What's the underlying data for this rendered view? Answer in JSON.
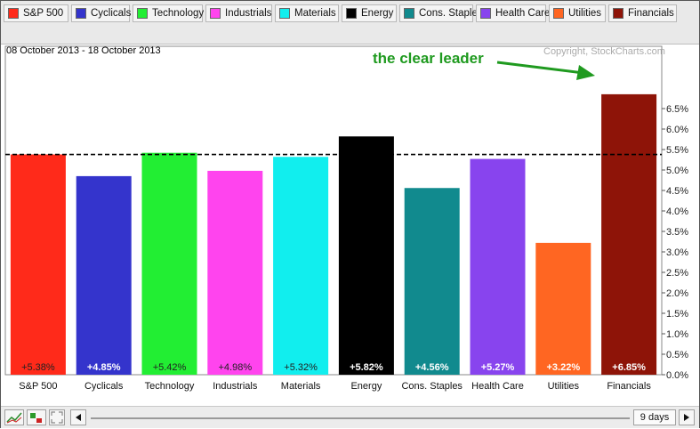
{
  "legend": [
    {
      "label": "S&P 500",
      "color": "#ff2a1a"
    },
    {
      "label": "Cyclicals",
      "color": "#3434cc"
    },
    {
      "label": "Technology",
      "color": "#22ee33"
    },
    {
      "label": "Industrials",
      "color": "#ff44ee"
    },
    {
      "label": "Materials",
      "color": "#11eeee"
    },
    {
      "label": "Energy",
      "color": "#000000"
    },
    {
      "label": "Cons. Staples",
      "color": "#118a8e"
    },
    {
      "label": "Health Care",
      "color": "#8844ee"
    },
    {
      "label": "Utilities",
      "color": "#ff6622"
    },
    {
      "label": "Financials",
      "color": "#8e1408"
    }
  ],
  "header": {
    "date_range": "08 October 2013 - 18 October 2013",
    "copyright": "Copyright, StockCharts.com",
    "annotation": "the clear leader"
  },
  "toolbar": {
    "days_label": "9 days",
    "scroll_left_icon": "triangle-left-icon",
    "scroll_right_icon": "triangle-right-icon"
  },
  "chart_data": {
    "type": "bar",
    "categories": [
      "S&P 500",
      "Cyclicals",
      "Technology",
      "Industrials",
      "Materials",
      "Energy",
      "Cons. Staples",
      "Health Care",
      "Utilities",
      "Financials"
    ],
    "values": [
      5.38,
      4.85,
      5.42,
      4.98,
      5.32,
      5.82,
      4.56,
      5.27,
      3.22,
      6.85
    ],
    "data_labels": [
      "+5.38%",
      "+4.85%",
      "+5.42%",
      "+4.98%",
      "+5.32%",
      "+5.82%",
      "+4.56%",
      "+5.27%",
      "+3.22%",
      "+6.85%"
    ],
    "colors": [
      "#ff2a1a",
      "#3434cc",
      "#22ee33",
      "#ff44ee",
      "#11eeee",
      "#000000",
      "#118a8e",
      "#8844ee",
      "#ff6622",
      "#8e1408"
    ],
    "label_colors": [
      "#222222",
      "#ffffff",
      "#222222",
      "#222222",
      "#222222",
      "#ffffff",
      "#ffffff",
      "#ffffff",
      "#ffffff",
      "#ffffff"
    ],
    "yticks": [
      "0.0%",
      "0.5%",
      "1.0%",
      "1.5%",
      "2.0%",
      "2.5%",
      "3.0%",
      "3.5%",
      "4.0%",
      "4.5%",
      "5.0%",
      "5.5%",
      "6.0%",
      "6.5%"
    ],
    "ylim": [
      0,
      7.0
    ],
    "reference_line": 5.38,
    "grid": false,
    "ylabel_position": "right"
  }
}
